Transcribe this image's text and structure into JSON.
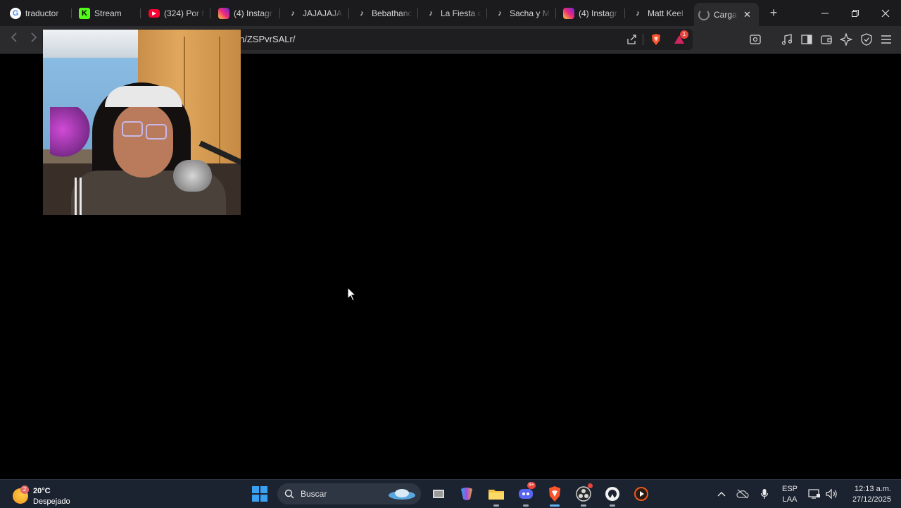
{
  "browser": {
    "tabs": [
      {
        "title": "traductor",
        "icon": "google-icon",
        "color": "#4285f4"
      },
      {
        "title": "Stream",
        "icon": "kick-icon",
        "color": "#53fc18"
      },
      {
        "title": "(324) Por f",
        "icon": "youtube-icon",
        "color": "#ff0033"
      },
      {
        "title": "(4) Instagr",
        "icon": "instagram-icon",
        "color": "#e1306c"
      },
      {
        "title": "JAJAJAJA",
        "icon": "tiktok-icon",
        "color": "#ffffff"
      },
      {
        "title": "Bebathanc",
        "icon": "tiktok-icon",
        "color": "#ffffff"
      },
      {
        "title": "La Fiesta d",
        "icon": "tiktok-icon",
        "color": "#ffffff"
      },
      {
        "title": "Sacha y M",
        "icon": "tiktok-icon",
        "color": "#ffffff"
      },
      {
        "title": "(4) Instagr",
        "icon": "instagram-icon",
        "color": "#e1306c"
      },
      {
        "title": "Matt Keel",
        "icon": "tiktok-icon",
        "color": "#ffffff"
      },
      {
        "title": "Carga",
        "icon": "loading-spinner-icon",
        "color": "#cccccc",
        "active": true
      }
    ],
    "url": "n/ZSPvrSALr/",
    "brave_shield_color": "#fb542b",
    "rewards_badge": "1"
  },
  "taskbar": {
    "weather": {
      "badge": "2",
      "temp": "20°C",
      "condition": "Despejado"
    },
    "search_placeholder": "Buscar",
    "apps": [
      {
        "name": "task-view-icon"
      },
      {
        "name": "m365-copilot-icon"
      },
      {
        "name": "file-explorer-icon"
      },
      {
        "name": "discord-icon",
        "badge": "9+"
      },
      {
        "name": "brave-browser-icon",
        "active": true
      },
      {
        "name": "obs-studio-icon"
      },
      {
        "name": "streamlabs-icon"
      },
      {
        "name": "media-player-icon"
      }
    ],
    "language": {
      "line1": "ESP",
      "line2": "LAA"
    },
    "clock": {
      "time": "12:13 a.m.",
      "date": "27/12/2025"
    }
  }
}
